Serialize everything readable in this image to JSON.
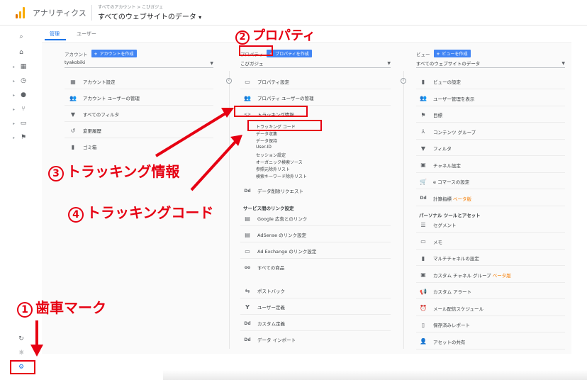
{
  "header": {
    "app_title": "アナリティクス",
    "breadcrumb": "すべてのアカウント > こびガジェ",
    "view_name": "すべてのウェブサイトのデータ",
    "view_caret": "▾"
  },
  "tabs": [
    {
      "label": "管理",
      "active": true
    },
    {
      "label": "ユーザー",
      "active": false
    }
  ],
  "account": {
    "label": "アカウント",
    "create_label": "アカウントを作成",
    "selected": "tyakobiki",
    "items": [
      {
        "icon": "building-icon",
        "glyph": "▦",
        "label": "アカウント設定"
      },
      {
        "icon": "users-icon",
        "glyph": "👥",
        "label": "アカウント ユーザーの管理"
      },
      {
        "icon": "filter-icon",
        "glyph": "▼",
        "label": "すべてのフィルタ"
      },
      {
        "icon": "history-icon",
        "glyph": "↺",
        "label": "変更履歴"
      },
      {
        "icon": "trash-icon",
        "glyph": "▮",
        "label": "ゴミ箱"
      }
    ]
  },
  "property": {
    "label": "プロパティ",
    "create_label": "プロパティを作成",
    "selected": "こびガジェ",
    "items": [
      {
        "icon": "settings-box-icon",
        "glyph": "▭",
        "label": "プロパティ設定"
      },
      {
        "icon": "users-icon",
        "glyph": "👥",
        "label": "プロパティ ユーザーの管理"
      },
      {
        "icon": "code-icon",
        "glyph": "<>",
        "label": "トラッキング情報"
      }
    ],
    "tracking_sub": [
      "トラッキング コード",
      "データ収集",
      "データ保持",
      "User-ID",
      "セッション設定",
      "オーガニック検索ソース",
      "参照元除外リスト",
      "検索キーワード除外リスト"
    ],
    "deletion": {
      "icon": "dd-icon",
      "glyph": "Dd",
      "label": "データ削除リクエスト"
    },
    "link_section_title": "サービス間のリンク設定",
    "link_items": [
      {
        "icon": "google-ads-icon",
        "glyph": "▤",
        "label": "Google 広告とのリンク"
      },
      {
        "icon": "adsense-icon",
        "glyph": "▤",
        "label": "AdSense のリンク設定"
      },
      {
        "icon": "ad-exchange-icon",
        "glyph": "▭",
        "label": "Ad Exchange のリンク設定"
      },
      {
        "icon": "products-icon",
        "glyph": "oo",
        "label": "すべての商品"
      }
    ],
    "other_items": [
      {
        "icon": "postback-icon",
        "glyph": "⇆",
        "label": "ポストバック"
      },
      {
        "icon": "user-definition-icon",
        "glyph": "Y",
        "label": "ユーザー定義"
      },
      {
        "icon": "dd-icon",
        "glyph": "Dd",
        "label": "カスタム定義"
      },
      {
        "icon": "dd-icon",
        "glyph": "Dd",
        "label": "データ インポート"
      }
    ]
  },
  "view": {
    "label": "ビュー",
    "create_label": "ビューを作成",
    "selected": "すべてのウェブサイトのデータ",
    "items": [
      {
        "icon": "document-icon",
        "glyph": "▮",
        "label": "ビューの設定",
        "beta": ""
      },
      {
        "icon": "users-icon",
        "glyph": "👥",
        "label": "ユーザー管理を表示",
        "beta": ""
      },
      {
        "icon": "flag-icon",
        "glyph": "⚑",
        "label": "目標",
        "beta": ""
      },
      {
        "icon": "content-group-icon",
        "glyph": "⅄",
        "label": "コンテンツ グループ",
        "beta": ""
      },
      {
        "icon": "filter-icon",
        "glyph": "▼",
        "label": "フィルタ",
        "beta": ""
      },
      {
        "icon": "channel-icon",
        "glyph": "▣",
        "label": "チャネル設定",
        "beta": ""
      },
      {
        "icon": "cart-icon",
        "glyph": "🛒",
        "label": "e コマースの設定",
        "beta": ""
      },
      {
        "icon": "dd-icon",
        "glyph": "Dd",
        "label": "計算指標",
        "beta": "ベータ版"
      }
    ],
    "personal_title": "パーソナル ツールとアセット",
    "personal_items": [
      {
        "icon": "segment-icon",
        "glyph": "☰",
        "label": "セグメント",
        "beta": ""
      },
      {
        "icon": "memo-icon",
        "glyph": "▭",
        "label": "メモ",
        "beta": ""
      },
      {
        "icon": "multichannel-icon",
        "glyph": "▮",
        "label": "マルチチャネルの設定",
        "beta": ""
      },
      {
        "icon": "custom-channel-icon",
        "glyph": "▣",
        "label": "カスタム チャネル グループ",
        "beta": "ベータ版"
      },
      {
        "icon": "megaphone-icon",
        "glyph": "📢",
        "label": "カスタム アラート",
        "beta": ""
      },
      {
        "icon": "schedule-icon",
        "glyph": "⏰",
        "label": "メール配信スケジュール",
        "beta": ""
      },
      {
        "icon": "saved-report-icon",
        "glyph": "▯",
        "label": "保存済みレポート",
        "beta": ""
      },
      {
        "icon": "asset-share-icon",
        "glyph": "👤",
        "label": "アセットの共有",
        "beta": ""
      }
    ]
  },
  "annotations": {
    "gear_label": "歯車マーク",
    "gear_num": "1",
    "property_label": "プロパティ",
    "property_num": "2",
    "tracking_info_label": "トラッキング情報",
    "tracking_info_num": "3",
    "tracking_code_label": "トラッキングコード",
    "tracking_code_num": "4"
  },
  "colors": {
    "accent": "#1a73e8",
    "button": "#4285f4",
    "annotation": "#e60012",
    "beta": "#f57c00"
  }
}
